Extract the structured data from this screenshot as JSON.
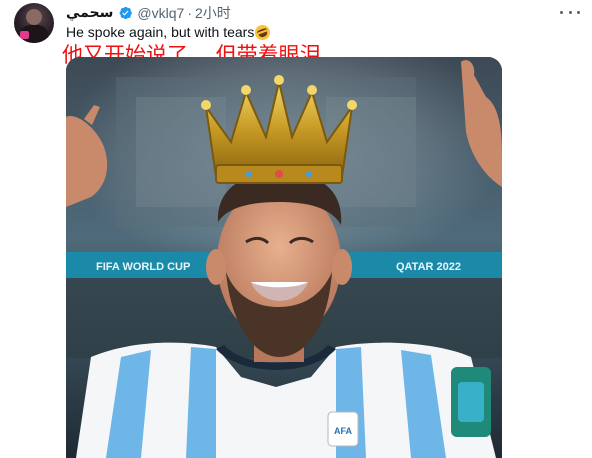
{
  "author": {
    "display_name": "سحمي",
    "handle": "@vklq7",
    "separator": "·",
    "time": "2小时",
    "verified": true,
    "avatar_icon": "profile-avatar"
  },
  "tweet": {
    "text": "He spoke again, but with tears",
    "emoji_icon": "rolling-on-floor-laughing-emoji",
    "translation_overlay": "他又开始说了， 但带着眼泪",
    "translation_color": "#ee1111"
  },
  "media": {
    "type": "photo",
    "subject_icon": "crowned-footballer-photo",
    "banner_text": "FIFA WORLD CUP",
    "badge_text": "AFA"
  },
  "menu": {
    "icon": "more-options-icon"
  },
  "colors": {
    "verified_blue": "#1d9bf0",
    "text_primary": "#0f1419",
    "text_secondary": "#536471"
  }
}
